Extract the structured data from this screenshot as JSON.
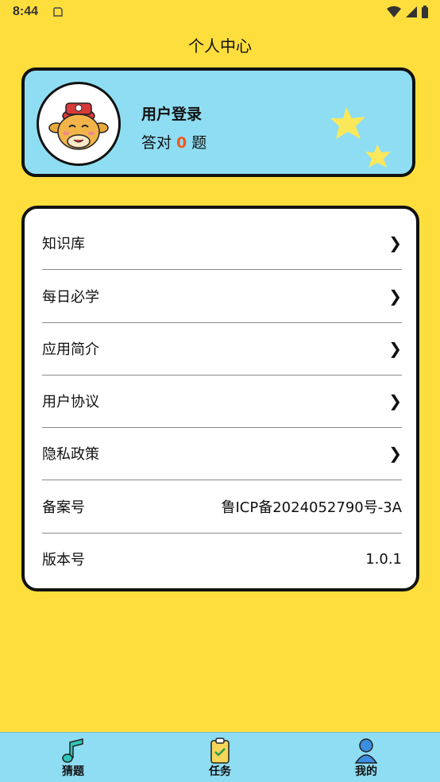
{
  "status_bar": {
    "time": "8:44"
  },
  "header": {
    "title": "个人中心"
  },
  "profile": {
    "login_label": "用户登录",
    "answer_prefix": "答对",
    "answer_count": "0",
    "answer_suffix": "题"
  },
  "menu": {
    "items": [
      {
        "label": "知识库"
      },
      {
        "label": "每日必学"
      },
      {
        "label": "应用简介"
      },
      {
        "label": "用户协议"
      },
      {
        "label": "隐私政策"
      }
    ],
    "icp": {
      "label": "备案号",
      "value": "鲁ICP备2024052790号-3A"
    },
    "version": {
      "label": "版本号",
      "value": "1.0.1"
    }
  },
  "nav": {
    "items": [
      {
        "label": "猜题"
      },
      {
        "label": "任务"
      },
      {
        "label": "我的"
      }
    ]
  },
  "colors": {
    "background": "#FEDE3C",
    "card_blue": "#8FDDF3",
    "accent": "#F2581C"
  }
}
